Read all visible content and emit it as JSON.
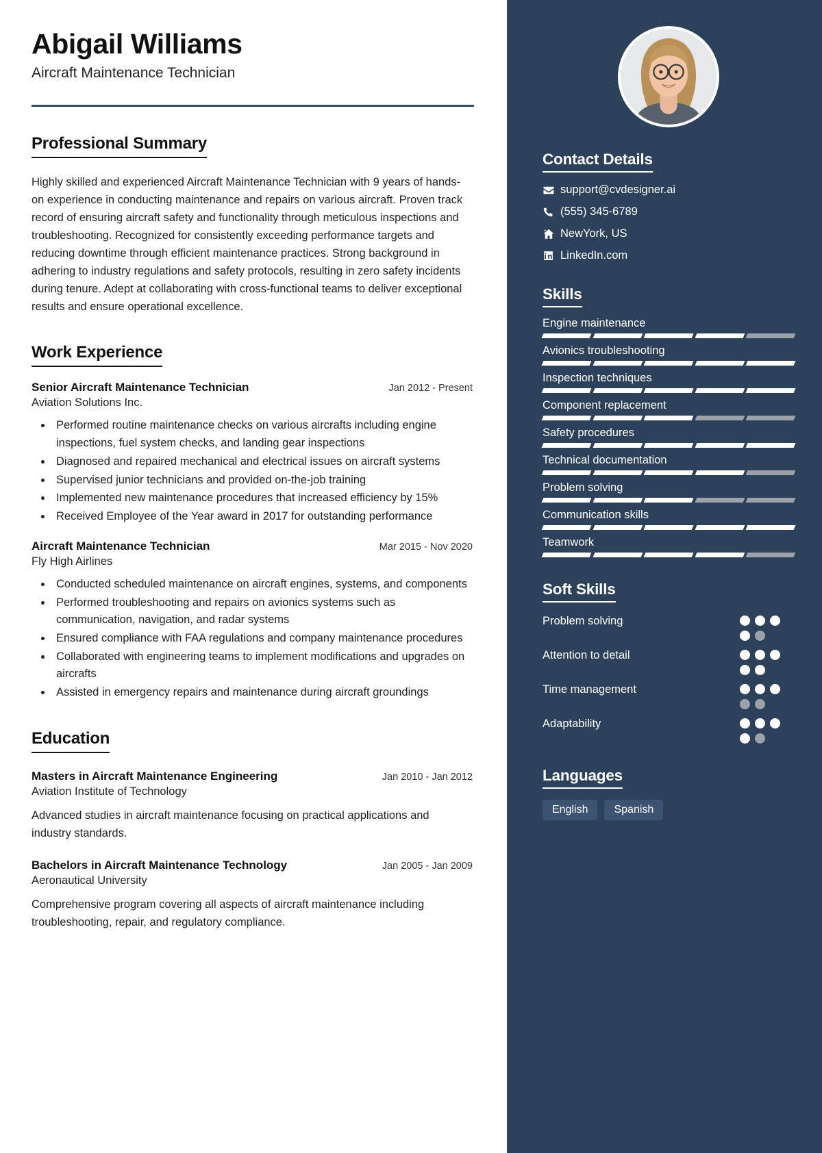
{
  "header": {
    "name": "Abigail Williams",
    "job_title": "Aircraft Maintenance Technician"
  },
  "sections": {
    "summary_title": "Professional Summary",
    "summary_text": "Highly skilled and experienced Aircraft Maintenance Technician with 9 years of hands-on experience in conducting maintenance and repairs on various aircraft. Proven track record of ensuring aircraft safety and functionality through meticulous inspections and troubleshooting. Recognized for consistently exceeding performance targets and reducing downtime through efficient maintenance practices. Strong background in adhering to industry regulations and safety protocols, resulting in zero safety incidents during tenure. Adept at collaborating with cross-functional teams to deliver exceptional results and ensure operational excellence.",
    "work_title": "Work Experience",
    "education_title": "Education"
  },
  "work": [
    {
      "role": "Senior Aircraft Maintenance Technician",
      "date": "Jan 2012 - Present",
      "org": "Aviation Solutions Inc.",
      "bullets": [
        "Performed routine maintenance checks on various aircrafts including engine inspections, fuel system checks, and landing gear inspections",
        "Diagnosed and repaired mechanical and electrical issues on aircraft systems",
        "Supervised junior technicians and provided on-the-job training",
        "Implemented new maintenance procedures that increased efficiency by 15%",
        "Received Employee of the Year award in 2017 for outstanding performance"
      ]
    },
    {
      "role": "Aircraft Maintenance Technician",
      "date": "Mar 2015 - Nov 2020",
      "org": "Fly High Airlines",
      "bullets": [
        "Conducted scheduled maintenance on aircraft engines, systems, and components",
        "Performed troubleshooting and repairs on avionics systems such as communication, navigation, and radar systems",
        "Ensured compliance with FAA regulations and company maintenance procedures",
        "Collaborated with engineering teams to implement modifications and upgrades on aircrafts",
        "Assisted in emergency repairs and maintenance during aircraft groundings"
      ]
    }
  ],
  "education": [
    {
      "degree": "Masters in Aircraft Maintenance Engineering",
      "date": "Jan 2010 - Jan 2012",
      "school": "Aviation Institute of Technology",
      "description": "Advanced studies in aircraft maintenance focusing on practical applications and industry standards."
    },
    {
      "degree": "Bachelors in Aircraft Maintenance Technology",
      "date": "Jan 2005 - Jan 2009",
      "school": "Aeronautical University",
      "description": "Comprehensive program covering all aspects of aircraft maintenance including troubleshooting, repair, and regulatory compliance."
    }
  ],
  "sidebar": {
    "contact_title": "Contact Details",
    "contacts": [
      {
        "icon": "envelope-icon",
        "value": "support@cvdesigner.ai"
      },
      {
        "icon": "phone-icon",
        "value": "(555) 345-6789"
      },
      {
        "icon": "home-icon",
        "value": "NewYork, US"
      },
      {
        "icon": "linkedin-icon",
        "value": "LinkedIn.com"
      }
    ],
    "skills_title": "Skills",
    "skills": [
      {
        "name": "Engine maintenance",
        "segments": 5,
        "filled": 4
      },
      {
        "name": "Avionics troubleshooting",
        "segments": 5,
        "filled": 5
      },
      {
        "name": "Inspection techniques",
        "segments": 5,
        "filled": 5
      },
      {
        "name": "Component replacement",
        "segments": 5,
        "filled": 3
      },
      {
        "name": "Safety procedures",
        "segments": 5,
        "filled": 5
      },
      {
        "name": "Technical documentation",
        "segments": 5,
        "filled": 4
      },
      {
        "name": "Problem solving",
        "segments": 5,
        "filled": 3
      },
      {
        "name": "Communication skills",
        "segments": 5,
        "filled": 5
      },
      {
        "name": "Teamwork",
        "segments": 5,
        "filled": 4
      }
    ],
    "soft_skills_title": "Soft Skills",
    "soft_skills": [
      {
        "name": "Problem solving",
        "dots": 5,
        "filled": 4
      },
      {
        "name": "Attention to detail",
        "dots": 5,
        "filled": 5
      },
      {
        "name": "Time management",
        "dots": 5,
        "filled": 3
      },
      {
        "name": "Adaptability",
        "dots": 5,
        "filled": 4
      }
    ],
    "languages_title": "Languages",
    "languages": [
      "English",
      "Spanish"
    ]
  },
  "colors": {
    "sidebar_bg": "#2d415a",
    "accent_rule": "#37495c",
    "segment_on": "#ffffff",
    "segment_off": "#9aa2ab",
    "pill_bg": "#3d5372"
  }
}
